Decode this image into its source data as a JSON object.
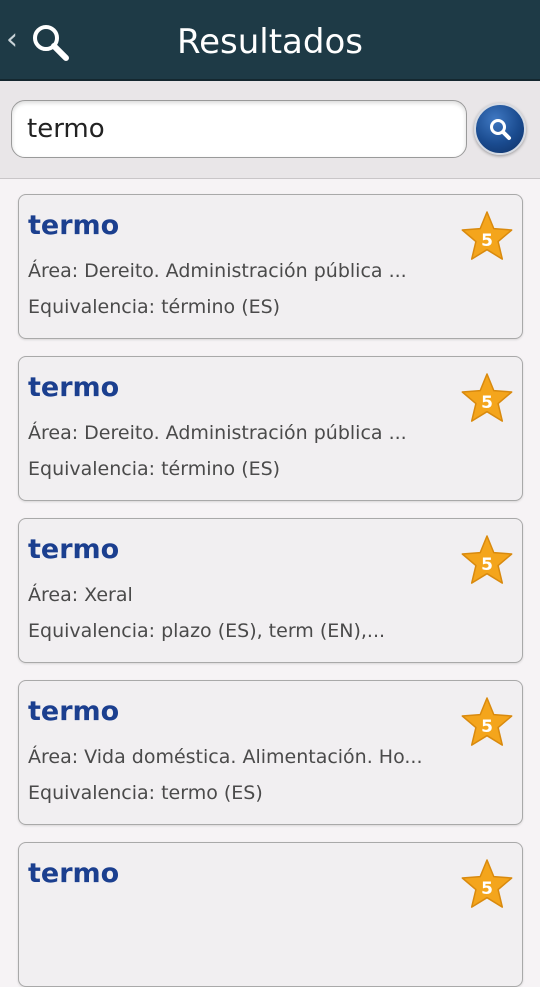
{
  "header": {
    "title": "Resultados",
    "back_glyph": "‹"
  },
  "search": {
    "value": "termo"
  },
  "colors": {
    "header_bg": "#1e3a46",
    "title_blue": "#1b3f8f",
    "star": "#f4a51c",
    "search_button": "#1a4b8f"
  },
  "results": [
    {
      "title": "termo",
      "area": "Área: Dereito. Administración pública ...",
      "equivalence": "Equivalencia: término (ES)",
      "rating": "5"
    },
    {
      "title": "termo",
      "area": "Área: Dereito. Administración pública ...",
      "equivalence": "Equivalencia: término (ES)",
      "rating": "5"
    },
    {
      "title": "termo",
      "area": "Área: Xeral",
      "equivalence": "Equivalencia: plazo (ES), term (EN),...",
      "rating": "5"
    },
    {
      "title": "termo",
      "area": "Área: Vida doméstica. Alimentación. Ho...",
      "equivalence": "Equivalencia: termo (ES)",
      "rating": "5"
    },
    {
      "title": "termo",
      "area": "",
      "equivalence": "",
      "rating": "5"
    }
  ]
}
